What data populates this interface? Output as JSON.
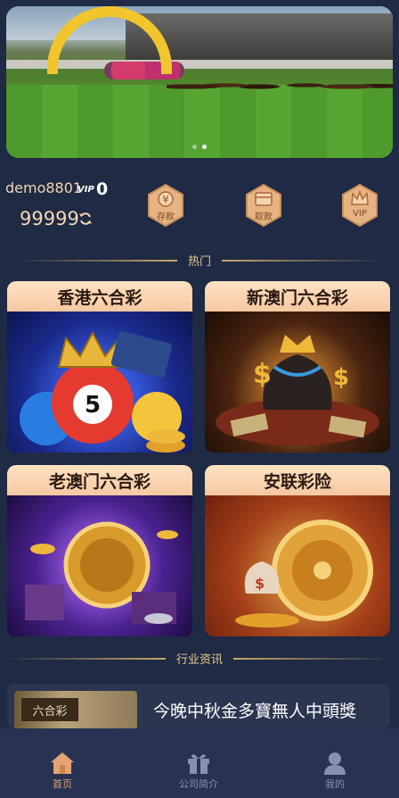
{
  "banner": {
    "slides": 2,
    "active_slide": 2
  },
  "user": {
    "username": "demo8801",
    "vip_tag": "VIP",
    "vip_level": "0",
    "balance": "99999"
  },
  "actions": [
    {
      "label": "存款",
      "icon": "yen-icon"
    },
    {
      "label": "取款",
      "icon": "wallet-icon"
    },
    {
      "label": "VIP",
      "icon": "crown-icon"
    }
  ],
  "sections": {
    "hot": "热门",
    "news": "行业资讯"
  },
  "games": [
    {
      "title": "香港六合彩"
    },
    {
      "title": "新澳门六合彩"
    },
    {
      "title": "老澳门六合彩"
    },
    {
      "title": "安联彩险"
    }
  ],
  "news": {
    "thumb_text": "六合彩",
    "title": "今晚中秋金多寶無人中頭獎"
  },
  "tabbar": {
    "items": [
      {
        "label": "首页",
        "icon": "home-icon",
        "active": true
      },
      {
        "label": "公司简介",
        "icon": "gift-icon",
        "active": false
      },
      {
        "label": "我的",
        "icon": "user-icon",
        "active": false
      }
    ]
  },
  "colors": {
    "background": "#1f2a44",
    "gold_text": "#f3d7b3",
    "accent": "#e0a26e",
    "tabbar": "#283353"
  }
}
